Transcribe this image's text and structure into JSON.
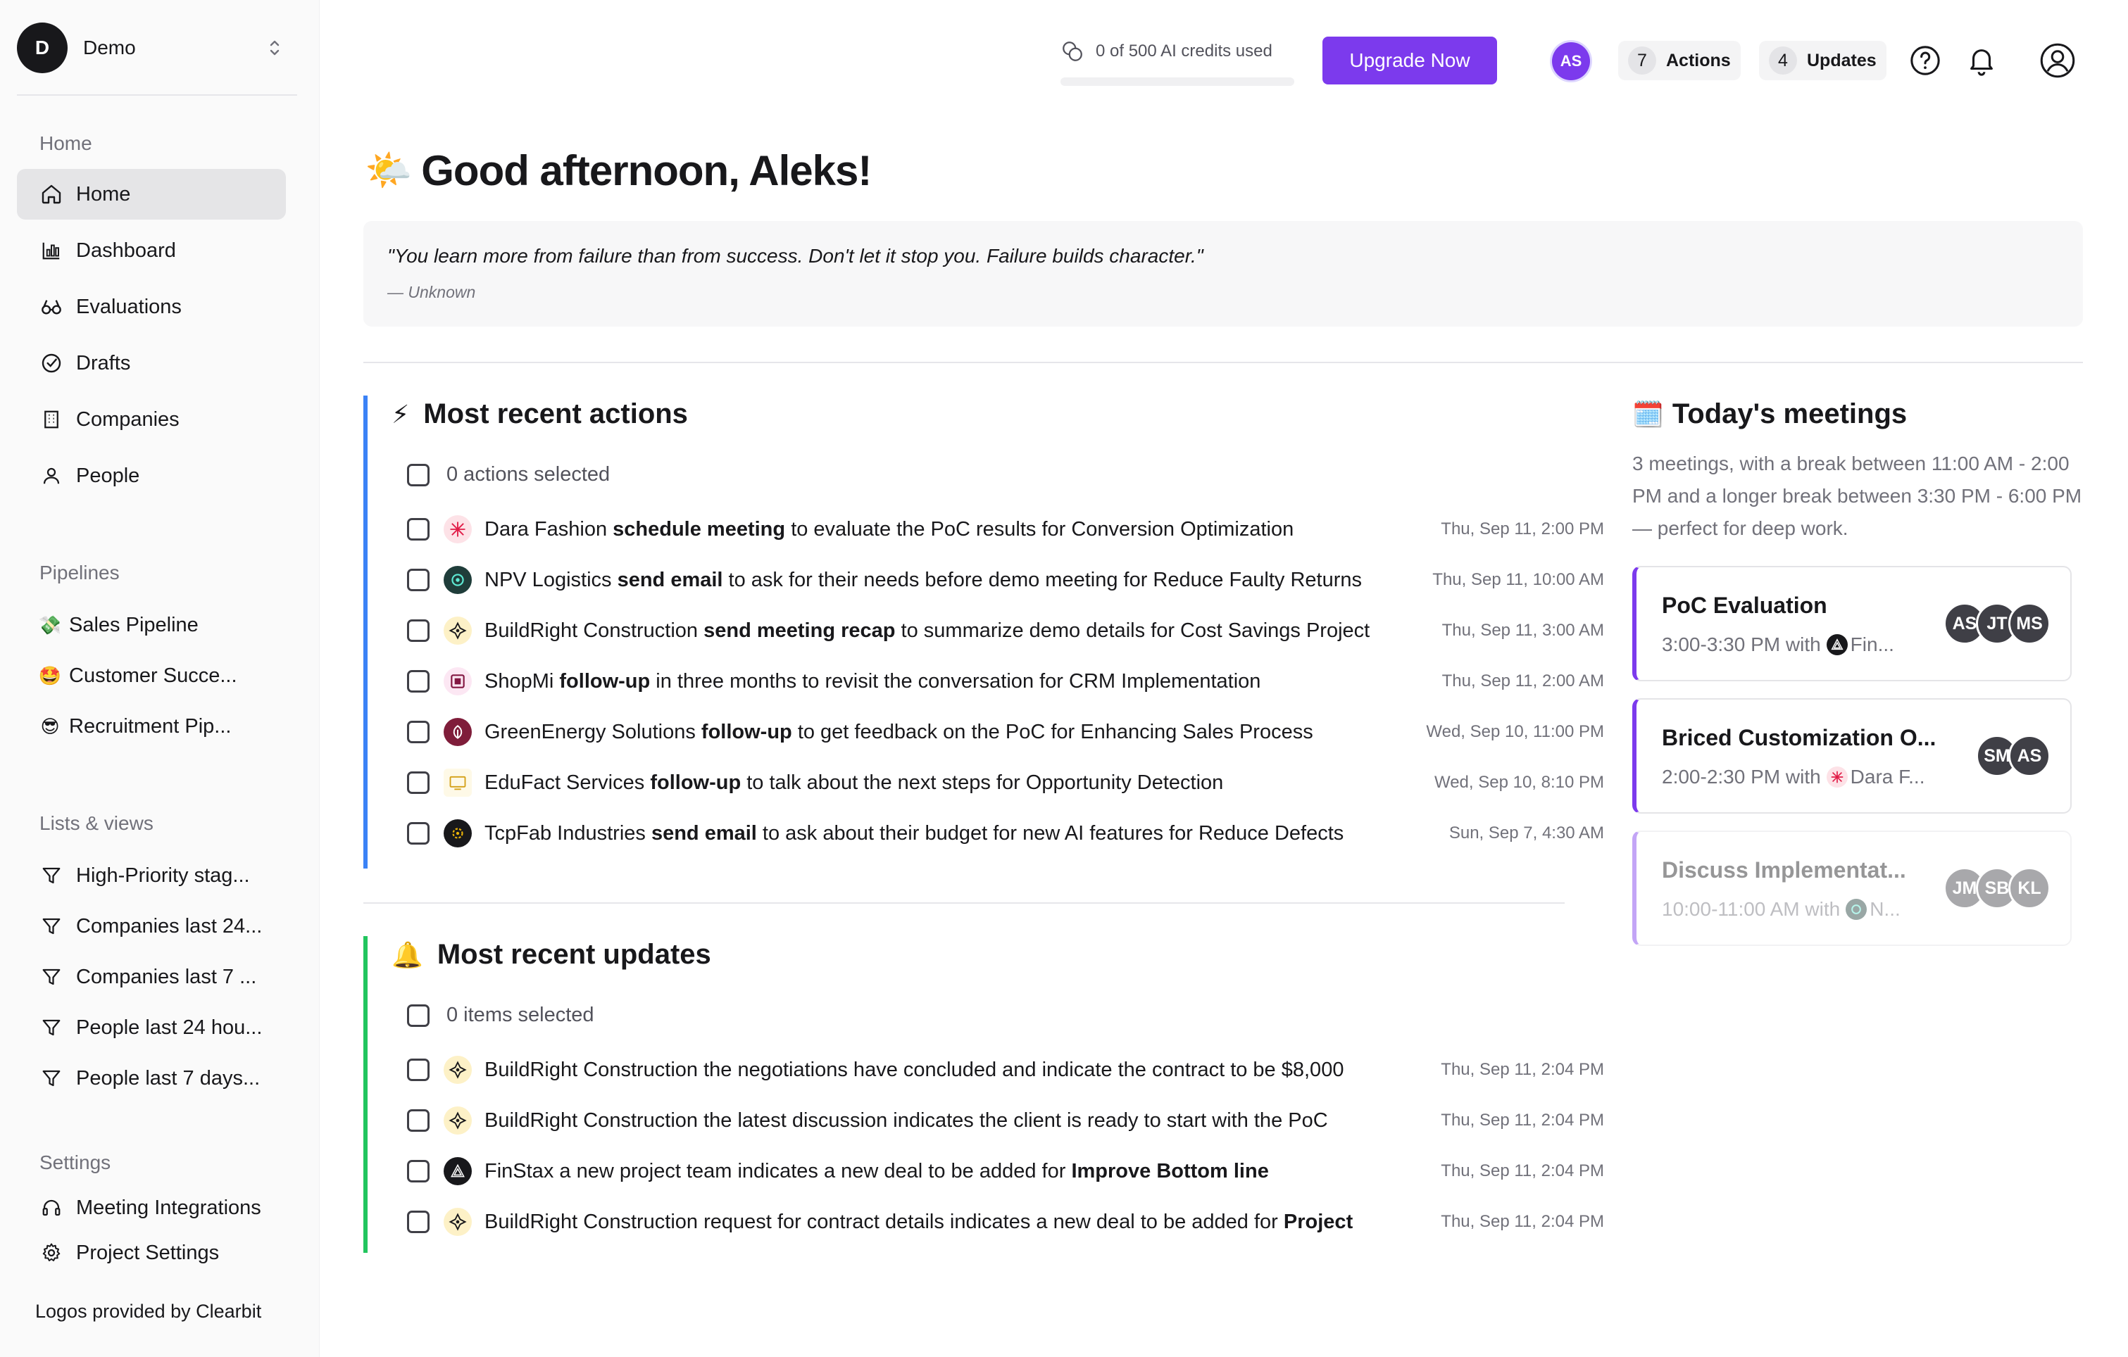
{
  "sidebar": {
    "workspace": {
      "initial": "D",
      "name": "Demo"
    },
    "sections": {
      "home": "Home",
      "pipelines": "Pipelines",
      "lists": "Lists & views",
      "settings": "Settings"
    },
    "home_items": [
      {
        "label": "Home",
        "icon": "home-icon",
        "active": true
      },
      {
        "label": "Dashboard",
        "icon": "bar-chart-icon"
      },
      {
        "label": "Evaluations",
        "icon": "binoculars-icon"
      },
      {
        "label": "Drafts",
        "icon": "check-circle-icon"
      },
      {
        "label": "Companies",
        "icon": "building-icon"
      },
      {
        "label": "People",
        "icon": "user-icon"
      }
    ],
    "pipeline_items": [
      {
        "label": "Sales Pipeline",
        "emoji": "💸"
      },
      {
        "label": "Customer Succe...",
        "emoji": "🤩"
      },
      {
        "label": "Recruitment Pip...",
        "emoji": "😎"
      }
    ],
    "list_items": [
      {
        "label": "High-Priority stag...",
        "icon": "filter-icon"
      },
      {
        "label": "Companies last 24...",
        "icon": "filter-icon"
      },
      {
        "label": "Companies last 7 ...",
        "icon": "filter-icon"
      },
      {
        "label": "People last 24 hou...",
        "icon": "filter-icon"
      },
      {
        "label": "People last 7 days...",
        "icon": "filter-icon"
      }
    ],
    "settings_items": [
      {
        "label": "Meeting Integrations",
        "icon": "headset-icon"
      },
      {
        "label": "Project Settings",
        "icon": "gear-icon"
      }
    ],
    "footer": "Logos provided by Clearbit"
  },
  "topbar": {
    "credits_text": "0 of 500 AI credits used",
    "credits_used_fraction": 0,
    "upgrade_label": "Upgrade Now",
    "user_initials": "AS",
    "actions_count": "7",
    "actions_label": "Actions",
    "updates_count": "4",
    "updates_label": "Updates",
    "accent": "#7c3aed"
  },
  "greeting": {
    "emoji": "🌤️",
    "text": "Good afternoon, Aleks!"
  },
  "quote": {
    "text": "\"You learn more from failure than from success. Don't let it stop you. Failure builds character.\"",
    "author": "— Unknown"
  },
  "actions": {
    "emoji": "⚡",
    "title": "Most recent actions",
    "selected_text": "0 actions selected",
    "rows": [
      {
        "company": "Dara Fashion",
        "verb": "schedule meeting",
        "rest": "to evaluate the PoC results for Conversion Optimization",
        "time": "Thu, Sep 11, 2:00 PM",
        "logo": "dara-logo-icon"
      },
      {
        "company": "NPV Logistics",
        "verb": "send email",
        "rest": "to ask for their needs before demo meeting for Reduce Faulty Returns",
        "time": "Thu, Sep 11, 10:00 AM",
        "logo": "npv-logo-icon"
      },
      {
        "company": "BuildRight Construction",
        "verb": "send meeting recap",
        "rest": "to summarize demo details for Cost Savings Project",
        "time": "Thu, Sep 11, 3:00 AM",
        "logo": "buildright-logo-icon"
      },
      {
        "company": "ShopMi",
        "verb": "follow-up",
        "rest": "in three months to revisit the conversation for CRM Implementation",
        "time": "Thu, Sep 11, 2:00 AM",
        "logo": "shopmi-logo-icon"
      },
      {
        "company": "GreenEnergy Solutions",
        "verb": "follow-up",
        "rest": "to get feedback on the PoC for Enhancing Sales Process",
        "time": "Wed, Sep 10, 11:00 PM",
        "logo": "greenenergy-logo-icon"
      },
      {
        "company": "EduFact Services",
        "verb": "follow-up",
        "rest": "to talk about the next steps for Opportunity Detection",
        "time": "Wed, Sep 10, 8:10 PM",
        "logo": "edufact-logo-icon"
      },
      {
        "company": "TcpFab Industries",
        "verb": "send email",
        "rest": "to ask about their budget for new AI features for Reduce Defects",
        "time": "Sun, Sep 7, 4:30 AM",
        "logo": "tcpfab-logo-icon"
      }
    ]
  },
  "updates": {
    "emoji": "🔔",
    "title": "Most recent updates",
    "selected_text": "0 items selected",
    "rows": [
      {
        "company": "BuildRight Construction",
        "text": "the negotiations have concluded and indicate the contract to be $8,000",
        "bold": "",
        "time": "Thu, Sep 11, 2:04 PM",
        "logo": "buildright-logo-icon"
      },
      {
        "company": "BuildRight Construction",
        "text": "the latest discussion indicates the client is ready to start with the PoC",
        "bold": "",
        "time": "Thu, Sep 11, 2:04 PM",
        "logo": "buildright-logo-icon"
      },
      {
        "company": "FinStax",
        "text": "a new project team indicates a new deal to be added for",
        "bold": "Improve Bottom line",
        "time": "Thu, Sep 11, 2:04 PM",
        "logo": "finstax-logo-icon"
      },
      {
        "company": "BuildRight Construction",
        "text": "request for contract details indicates a new deal to be added for",
        "bold": "Project",
        "time": "Thu, Sep 11, 2:04 PM",
        "logo": "buildright-logo-icon"
      }
    ]
  },
  "meetings": {
    "emoji": "🗓️",
    "title": "Today's meetings",
    "summary": "3 meetings, with a break between 11:00 AM - 2:00 PM and a longer break between 3:30 PM - 6:00 PM — perfect for deep work.",
    "cards": [
      {
        "title": "PoC Evaluation",
        "time": "3:00-3:30 PM with",
        "with": "Fin...",
        "logo": "finstax-logo-icon",
        "attendees": [
          "AS",
          "JT",
          "MS"
        ],
        "faded": false
      },
      {
        "title": "Briced Customization O...",
        "time": "2:00-2:30 PM with",
        "with": "Dara F...",
        "logo": "dara-logo-icon",
        "attendees": [
          "SM",
          "AS"
        ],
        "faded": false
      },
      {
        "title": "Discuss Implementat...",
        "time": "10:00-11:00 AM with",
        "with": "N...",
        "logo": "npv-logo-icon",
        "attendees": [
          "JM",
          "SB",
          "KL"
        ],
        "faded": true
      }
    ]
  }
}
